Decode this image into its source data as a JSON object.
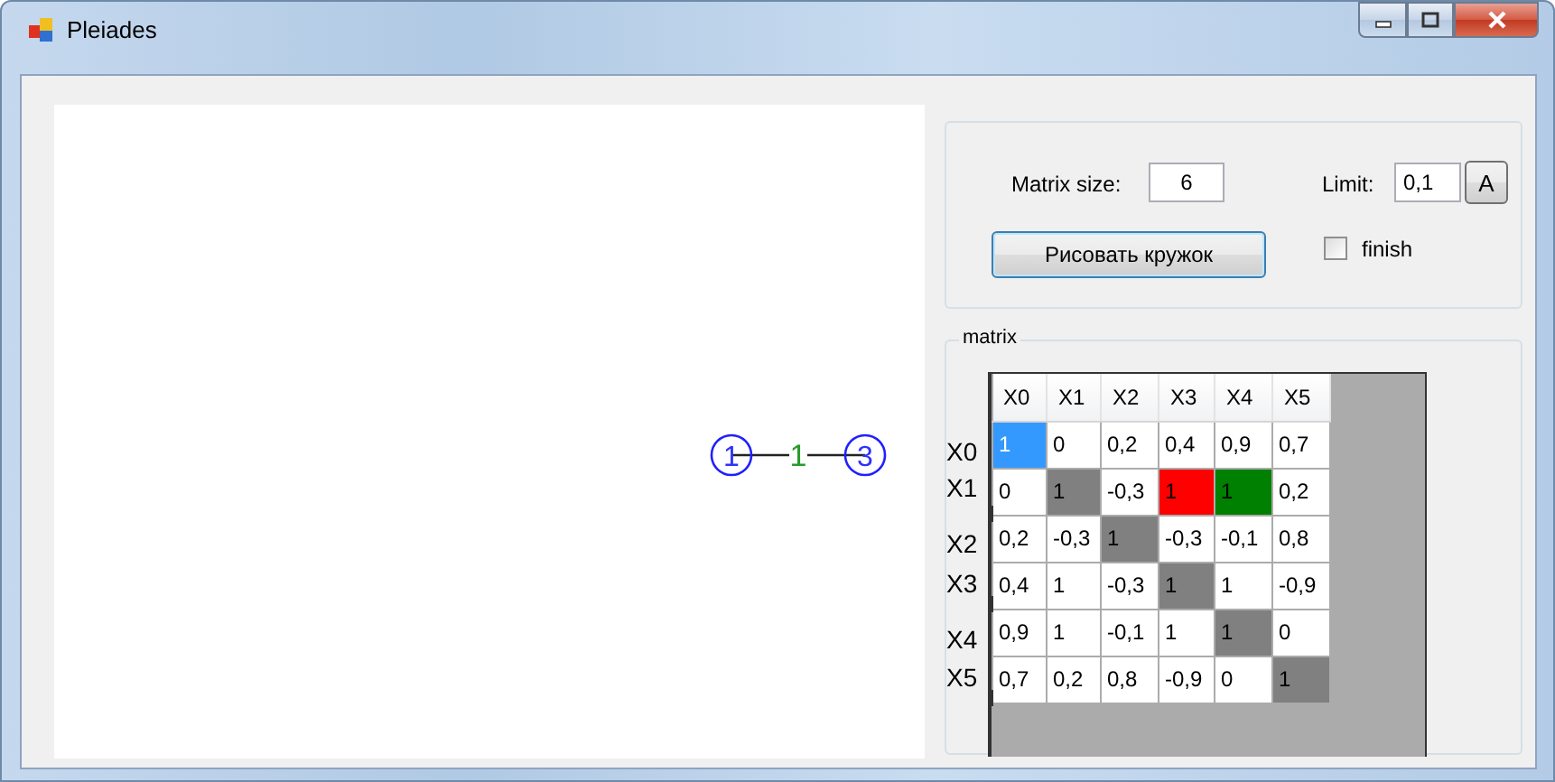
{
  "window": {
    "title": "Pleiades"
  },
  "graph": {
    "nodes": [
      {
        "label": "1"
      },
      {
        "label": "3"
      }
    ],
    "edges": [
      {
        "label": "1"
      }
    ]
  },
  "settings": {
    "matrix_size_label": "Matrix size:",
    "matrix_size": "6",
    "limit_label": "Limit:",
    "limit": "0,1",
    "apply_button": "A",
    "draw_button": "Рисовать кружок",
    "finish": {
      "label": "finish",
      "checked": false
    }
  },
  "matrix": {
    "title": "matrix",
    "columns": [
      "X0",
      "X1",
      "X2",
      "X3",
      "X4",
      "X5"
    ],
    "row_labels": [
      "X0",
      "X1",
      "X2",
      "X3",
      "X4",
      "X5"
    ],
    "rows": [
      [
        {
          "text": "1",
          "kind": "selected"
        },
        {
          "text": "0",
          "kind": "plain"
        },
        {
          "text": "0,2",
          "kind": "plain"
        },
        {
          "text": "0,4",
          "kind": "plain"
        },
        {
          "text": "0,9",
          "kind": "plain"
        },
        {
          "text": "0,7",
          "kind": "plain"
        }
      ],
      [
        {
          "text": "0",
          "kind": "plain"
        },
        {
          "text": "1",
          "kind": "diagonal"
        },
        {
          "text": "-0,3",
          "kind": "plain"
        },
        {
          "text": "1",
          "kind": "red"
        },
        {
          "text": "1",
          "kind": "green"
        },
        {
          "text": "0,2",
          "kind": "plain"
        }
      ],
      [
        {
          "text": "0,2",
          "kind": "plain"
        },
        {
          "text": "-0,3",
          "kind": "plain"
        },
        {
          "text": "1",
          "kind": "diagonal"
        },
        {
          "text": "-0,3",
          "kind": "plain"
        },
        {
          "text": "-0,1",
          "kind": "plain"
        },
        {
          "text": "0,8",
          "kind": "plain"
        }
      ],
      [
        {
          "text": "0,4",
          "kind": "plain"
        },
        {
          "text": "1",
          "kind": "plain"
        },
        {
          "text": "-0,3",
          "kind": "plain"
        },
        {
          "text": "1",
          "kind": "diagonal"
        },
        {
          "text": "1",
          "kind": "plain"
        },
        {
          "text": "-0,9",
          "kind": "plain"
        }
      ],
      [
        {
          "text": "0,9",
          "kind": "plain"
        },
        {
          "text": "1",
          "kind": "plain"
        },
        {
          "text": "-0,1",
          "kind": "plain"
        },
        {
          "text": "1",
          "kind": "plain"
        },
        {
          "text": "1",
          "kind": "diagonal"
        },
        {
          "text": "0",
          "kind": "plain"
        }
      ],
      [
        {
          "text": "0,7",
          "kind": "plain"
        },
        {
          "text": "0,2",
          "kind": "plain"
        },
        {
          "text": "0,8",
          "kind": "plain"
        },
        {
          "text": "-0,9",
          "kind": "plain"
        },
        {
          "text": "0",
          "kind": "plain"
        },
        {
          "text": "1",
          "kind": "diagonal"
        }
      ]
    ]
  }
}
